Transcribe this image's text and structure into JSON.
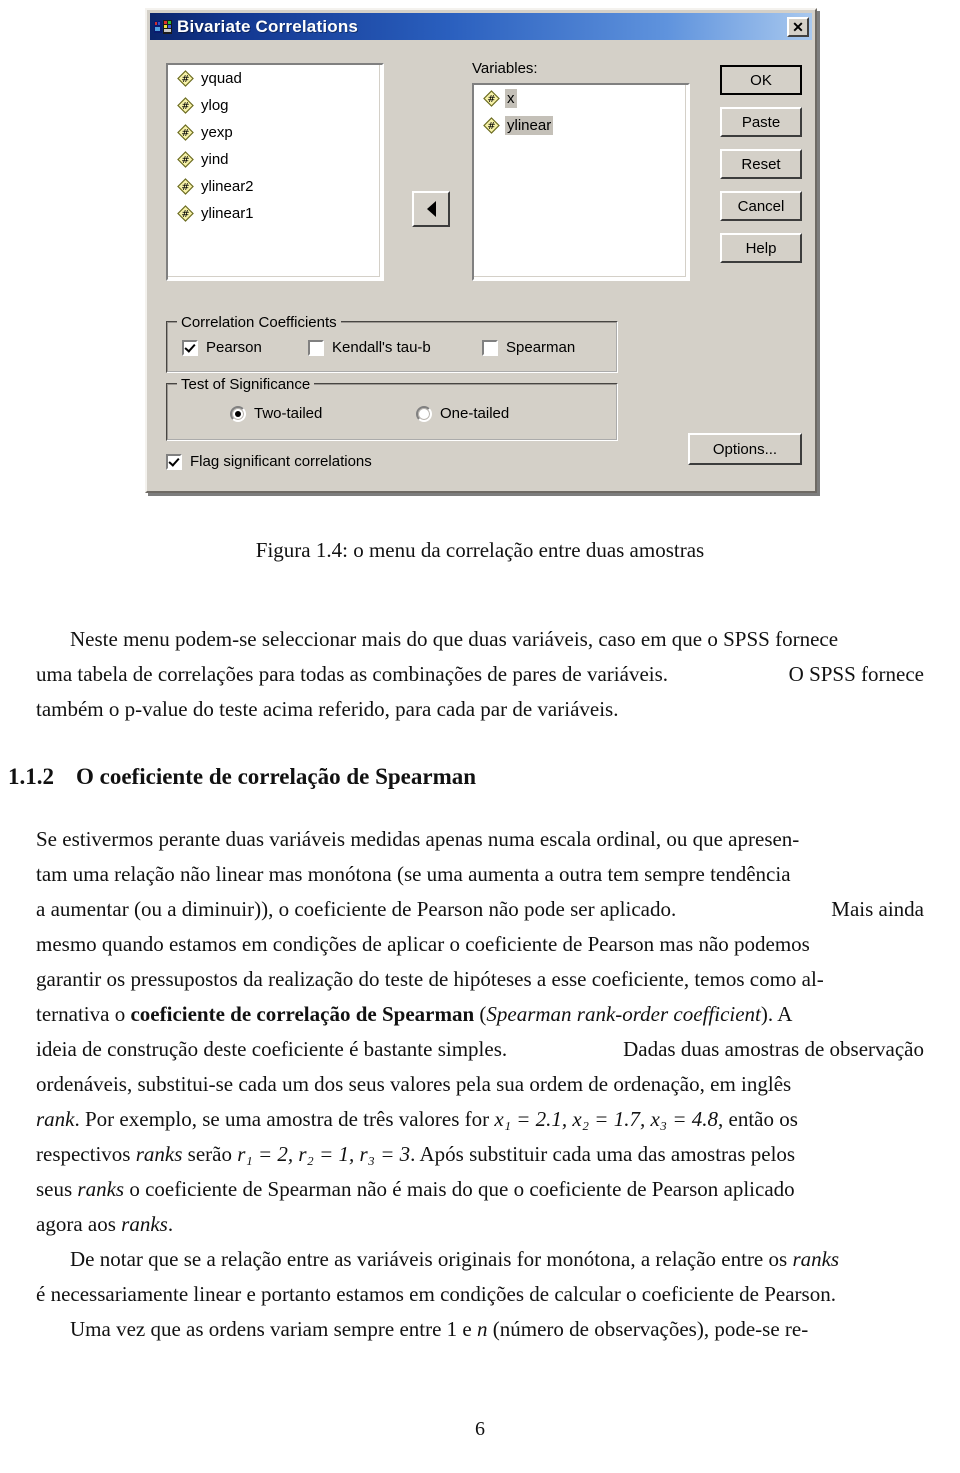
{
  "dialog": {
    "title": "Bivariate Correlations",
    "title_icon": "spss-variables-icon",
    "close_label": "✕",
    "source_variables": [
      {
        "name": "yquad",
        "icon": "scale-variable-icon",
        "selected": false
      },
      {
        "name": "ylog",
        "icon": "scale-variable-icon",
        "selected": false
      },
      {
        "name": "yexp",
        "icon": "scale-variable-icon",
        "selected": false
      },
      {
        "name": "yind",
        "icon": "scale-variable-icon",
        "selected": false
      },
      {
        "name": "ylinear2",
        "icon": "scale-variable-icon",
        "selected": false
      },
      {
        "name": "ylinear1",
        "icon": "scale-variable-icon",
        "selected": false
      }
    ],
    "variables_label": "Variables:",
    "selected_variables": [
      {
        "name": "x",
        "icon": "scale-variable-icon",
        "selected": true
      },
      {
        "name": "ylinear",
        "icon": "scale-variable-icon",
        "selected": true
      }
    ],
    "move_button": {
      "icon": "arrow-left-icon"
    },
    "buttons": {
      "ok": "OK",
      "paste": "Paste",
      "reset": "Reset",
      "cancel": "Cancel",
      "help": "Help",
      "options": "Options..."
    },
    "correlation_coefficients": {
      "group_title": "Correlation Coefficients",
      "items": [
        {
          "label": "Pearson",
          "checked": true
        },
        {
          "label": "Kendall's tau-b",
          "checked": false
        },
        {
          "label": "Spearman",
          "checked": false
        }
      ]
    },
    "test_of_significance": {
      "group_title": "Test of Significance",
      "items": [
        {
          "label": "Two-tailed",
          "selected": true
        },
        {
          "label": "One-tailed",
          "selected": false
        }
      ]
    },
    "flag_significant": {
      "label": "Flag significant correlations",
      "checked": true
    },
    "colors": {
      "face": "#d4d0c8",
      "titlebar_start": "#0a246a",
      "titlebar_end": "#a8c8ee",
      "variable_icon": "#f5f0a0",
      "selection": "#c4c0b8"
    }
  },
  "document": {
    "figure_caption": "Figura 1.4: o menu da correlação entre duas amostras",
    "paragraph_1": {
      "line1_a": "Neste menu podem-se seleccionar mais do que duas variáveis, caso em que o SPSS fornece",
      "line2_a": "uma tabela de correlações para todas as combinações de pares de variáveis.",
      "line2_b": "O SPSS fornece",
      "line3_a": "também o p-value do teste acima referido, para cada par de variáveis."
    },
    "section": {
      "number": "1.1.2",
      "title": "O coeficiente de correlação de Spearman"
    },
    "paragraph_2": {
      "line1_a": "Se estivermos perante duas variáveis medidas apenas numa escala ordinal, ou que apresen-",
      "line2_a": "tam uma relação não linear mas monótona (se uma aumenta a outra tem sempre tendência",
      "line3_a": "a aumentar (ou a diminuir)), o coeficiente de Pearson não pode ser aplicado.",
      "line3_b": "Mais ainda",
      "line4_a": "mesmo quando estamos em condições de aplicar o coeficiente de Pearson mas não podemos",
      "line5_a": "garantir os pressupostos da realização do teste de hipóteses a esse coeficiente, temos como al-",
      "line6_a": "ternativa o ",
      "line6_b": "coeficiente de correlação de Spearman",
      "line6_c": " (",
      "line6_d": "Spearman rank-order coefficient",
      "line6_e": "). A",
      "line7_a": "ideia de construção deste coeficiente é bastante simples.",
      "line7_b": "Dadas duas amostras de observação",
      "line8_a": "ordenáveis, substitui-se cada um dos seus valores pela sua ordem de ordenação, em inglês",
      "line9_a": "rank",
      "line9_b": ". Por exemplo, se uma amostra de três valores for ",
      "line9_c": "x₁ = 2.1, x₂ = 1.7, x₃ = 4.8",
      "line9_d": ", então os",
      "line10_a": "respectivos ",
      "line10_b": "ranks",
      "line10_c": " serão ",
      "line10_d": "r₁ = 2, r₂ = 1, r₃ = 3",
      "line10_e": ". Após substituir cada uma das amostras pelos",
      "line11_a": "seus ",
      "line11_b": "ranks",
      "line11_c": " o coeficiente de Spearman não é mais do que o coeficiente de Pearson aplicado",
      "line12_a": "agora aos ",
      "line12_b": "ranks",
      "line12_c": "."
    },
    "paragraph_3": {
      "line1_a": "De notar que se a relação entre as variáveis originais for monótona, a relação entre os ",
      "line1_b": "ranks",
      "line2_a": "é necessariamente linear e portanto estamos em condições de calcular o coeficiente de Pearson.",
      "line3_a": "Uma vez que as ordens variam sempre entre 1 e ",
      "line3_b": "n",
      "line3_c": " (número de observações), pode-se re-"
    },
    "page_number": "6"
  }
}
